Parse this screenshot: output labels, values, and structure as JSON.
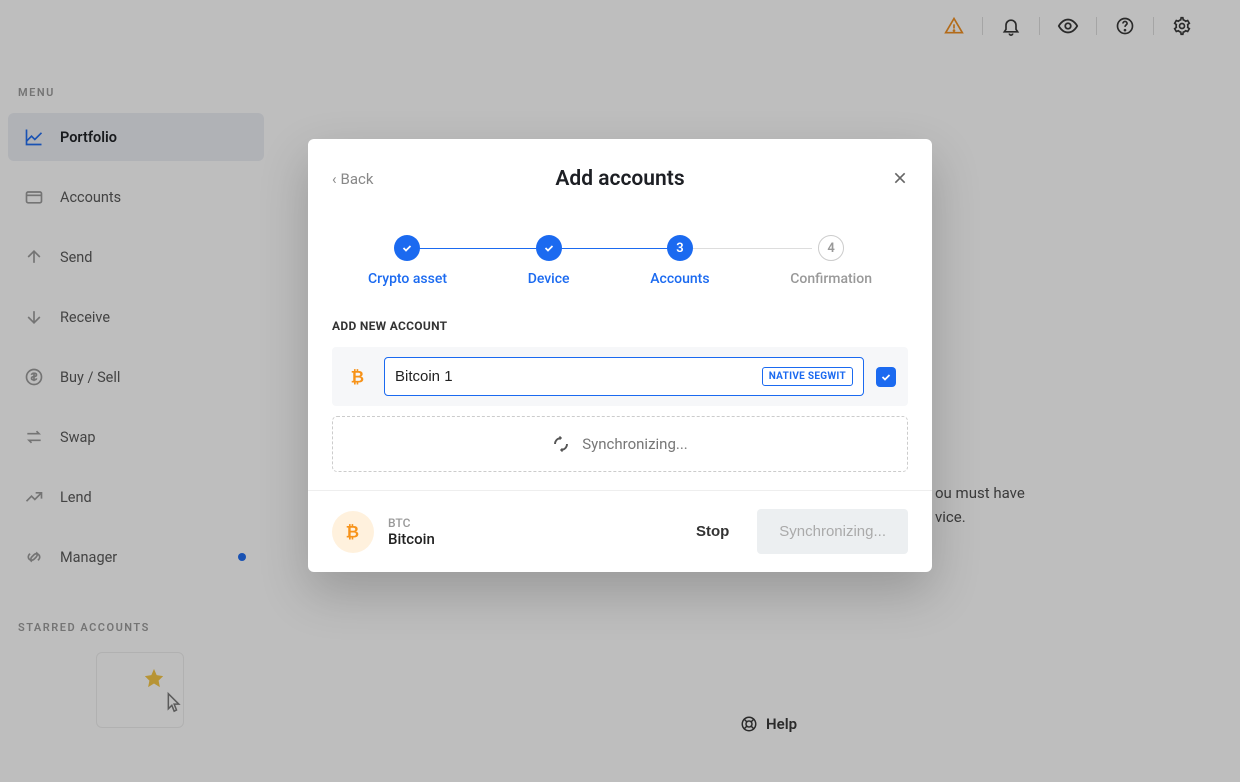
{
  "sidebar": {
    "menu_label": "MENU",
    "items": [
      {
        "label": "Portfolio"
      },
      {
        "label": "Accounts"
      },
      {
        "label": "Send"
      },
      {
        "label": "Receive"
      },
      {
        "label": "Buy / Sell"
      },
      {
        "label": "Swap"
      },
      {
        "label": "Lend"
      },
      {
        "label": "Manager"
      }
    ],
    "starred_label": "STARRED ACCOUNTS"
  },
  "modal": {
    "back_label": "Back",
    "title": "Add accounts",
    "steps": [
      {
        "label": "Crypto asset"
      },
      {
        "label": "Device"
      },
      {
        "label": "Accounts",
        "number": "3"
      },
      {
        "label": "Confirmation",
        "number": "4"
      }
    ],
    "section_label": "ADD NEW ACCOUNT",
    "account": {
      "name": "Bitcoin 1",
      "tag": "NATIVE SEGWIT",
      "coin_symbol": "bitcoin"
    },
    "syncing_label": "Synchronizing...",
    "footer": {
      "ticker": "BTC",
      "name": "Bitcoin",
      "stop_label": "Stop",
      "primary_label": "Synchronizing..."
    }
  },
  "background": {
    "line1": "ou must have",
    "line2": "vice.",
    "help_label": "Help"
  }
}
